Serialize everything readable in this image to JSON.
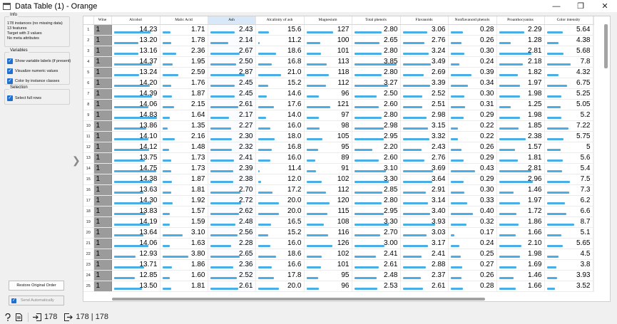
{
  "window": {
    "title": "Data Table (1) - Orange",
    "minimize": "—",
    "maximize": "❐",
    "close": "✕"
  },
  "info": {
    "title": "Info",
    "lines": [
      "178 instances (no missing data)",
      "13 features",
      "Target with 3 values",
      "No meta attributes"
    ]
  },
  "variables": {
    "title": "Variables",
    "options": [
      {
        "label": "Show variable labels (if present)",
        "checked": true
      },
      {
        "label": "Visualize numeric values",
        "checked": true
      },
      {
        "label": "Color by instance classes",
        "checked": true
      }
    ]
  },
  "selection": {
    "title": "Selection",
    "options": [
      {
        "label": "Select full rows",
        "checked": true
      }
    ]
  },
  "buttons": {
    "restore": "Restore Original Order",
    "send": "Send Automatically"
  },
  "status": {
    "input_count": "178",
    "output_count": "178 | 178"
  },
  "table": {
    "columns": [
      "Wine",
      "Alcohol",
      "Malic Acid",
      "Ash",
      "Alcalinity of ash",
      "Magnesium",
      "Total phenols",
      "Flavanoids",
      "Nonflavanoid phenols",
      "Proanthocyanins",
      "Color intensity"
    ],
    "column_ranges": [
      [
        0,
        0
      ],
      [
        11.03,
        14.83
      ],
      [
        0.74,
        5.8
      ],
      [
        1.36,
        3.23
      ],
      [
        10.6,
        30.0
      ],
      [
        70,
        162
      ],
      [
        0.98,
        3.88
      ],
      [
        0.34,
        5.08
      ],
      [
        0.13,
        0.66
      ],
      [
        0.41,
        3.58
      ],
      [
        1.28,
        13.0
      ]
    ],
    "selected_column": 3,
    "rows": [
      [
        "1",
        "14.23",
        "1.71",
        "2.43",
        "15.6",
        "127",
        "2.80",
        "3.06",
        "0.28",
        "2.29",
        "5.64"
      ],
      [
        "1",
        "13.20",
        "1.78",
        "2.14",
        "11.2",
        "100",
        "2.65",
        "2.76",
        "0.26",
        "1.28",
        "4.38"
      ],
      [
        "1",
        "13.16",
        "2.36",
        "2.67",
        "18.6",
        "101",
        "2.80",
        "3.24",
        "0.30",
        "2.81",
        "5.68"
      ],
      [
        "1",
        "14.37",
        "1.95",
        "2.50",
        "16.8",
        "113",
        "3.85",
        "3.49",
        "0.24",
        "2.18",
        "7.8"
      ],
      [
        "1",
        "13.24",
        "2.59",
        "2.87",
        "21.0",
        "118",
        "2.80",
        "2.69",
        "0.39",
        "1.82",
        "4.32"
      ],
      [
        "1",
        "14.20",
        "1.76",
        "2.45",
        "15.2",
        "112",
        "3.27",
        "3.39",
        "0.34",
        "1.97",
        "6.75"
      ],
      [
        "1",
        "14.39",
        "1.87",
        "2.45",
        "14.6",
        "96",
        "2.50",
        "2.52",
        "0.30",
        "1.98",
        "5.25"
      ],
      [
        "1",
        "14.06",
        "2.15",
        "2.61",
        "17.6",
        "121",
        "2.60",
        "2.51",
        "0.31",
        "1.25",
        "5.05"
      ],
      [
        "1",
        "14.83",
        "1.64",
        "2.17",
        "14.0",
        "97",
        "2.80",
        "2.98",
        "0.29",
        "1.98",
        "5.2"
      ],
      [
        "1",
        "13.86",
        "1.35",
        "2.27",
        "16.0",
        "98",
        "2.98",
        "3.15",
        "0.22",
        "1.85",
        "7.22"
      ],
      [
        "1",
        "14.10",
        "2.16",
        "2.30",
        "18.0",
        "105",
        "2.95",
        "3.32",
        "0.22",
        "2.38",
        "5.75"
      ],
      [
        "1",
        "14.12",
        "1.48",
        "2.32",
        "16.8",
        "95",
        "2.20",
        "2.43",
        "0.26",
        "1.57",
        "5"
      ],
      [
        "1",
        "13.75",
        "1.73",
        "2.41",
        "16.0",
        "89",
        "2.60",
        "2.76",
        "0.29",
        "1.81",
        "5.6"
      ],
      [
        "1",
        "14.75",
        "1.73",
        "2.39",
        "11.4",
        "91",
        "3.10",
        "3.69",
        "0.43",
        "2.81",
        "5.4"
      ],
      [
        "1",
        "14.38",
        "1.87",
        "2.38",
        "12.0",
        "102",
        "3.30",
        "3.64",
        "0.29",
        "2.96",
        "7.5"
      ],
      [
        "1",
        "13.63",
        "1.81",
        "2.70",
        "17.2",
        "112",
        "2.85",
        "2.91",
        "0.30",
        "1.46",
        "7.3"
      ],
      [
        "1",
        "14.30",
        "1.92",
        "2.72",
        "20.0",
        "120",
        "2.80",
        "3.14",
        "0.33",
        "1.97",
        "6.2"
      ],
      [
        "1",
        "13.83",
        "1.57",
        "2.62",
        "20.0",
        "115",
        "2.95",
        "3.40",
        "0.40",
        "1.72",
        "6.6"
      ],
      [
        "1",
        "14.19",
        "1.59",
        "2.48",
        "16.5",
        "108",
        "3.30",
        "3.93",
        "0.32",
        "1.86",
        "8.7"
      ],
      [
        "1",
        "13.64",
        "3.10",
        "2.56",
        "15.2",
        "116",
        "2.70",
        "3.03",
        "0.17",
        "1.66",
        "5.1"
      ],
      [
        "1",
        "14.06",
        "1.63",
        "2.28",
        "16.0",
        "126",
        "3.00",
        "3.17",
        "0.24",
        "2.10",
        "5.65"
      ],
      [
        "1",
        "12.93",
        "3.80",
        "2.65",
        "18.6",
        "102",
        "2.41",
        "2.41",
        "0.25",
        "1.98",
        "4.5"
      ],
      [
        "1",
        "13.71",
        "1.86",
        "2.36",
        "16.6",
        "101",
        "2.61",
        "2.88",
        "0.27",
        "1.69",
        "3.8"
      ],
      [
        "1",
        "12.85",
        "1.60",
        "2.52",
        "17.8",
        "95",
        "2.48",
        "2.37",
        "0.26",
        "1.46",
        "3.93"
      ],
      [
        "1",
        "13.50",
        "1.81",
        "2.61",
        "20.0",
        "96",
        "2.53",
        "2.61",
        "0.28",
        "1.66",
        "3.52"
      ]
    ]
  },
  "icons": {
    "help": "help-icon",
    "report": "report-icon",
    "input": "input-icon",
    "output": "output-icon",
    "expand": "chevron-right-icon"
  },
  "colors": {
    "bar": "#4aaee6",
    "accent": "#1f6fd1",
    "class_cell": "#9b9b9b",
    "selected_header": "#d8e8f8"
  }
}
